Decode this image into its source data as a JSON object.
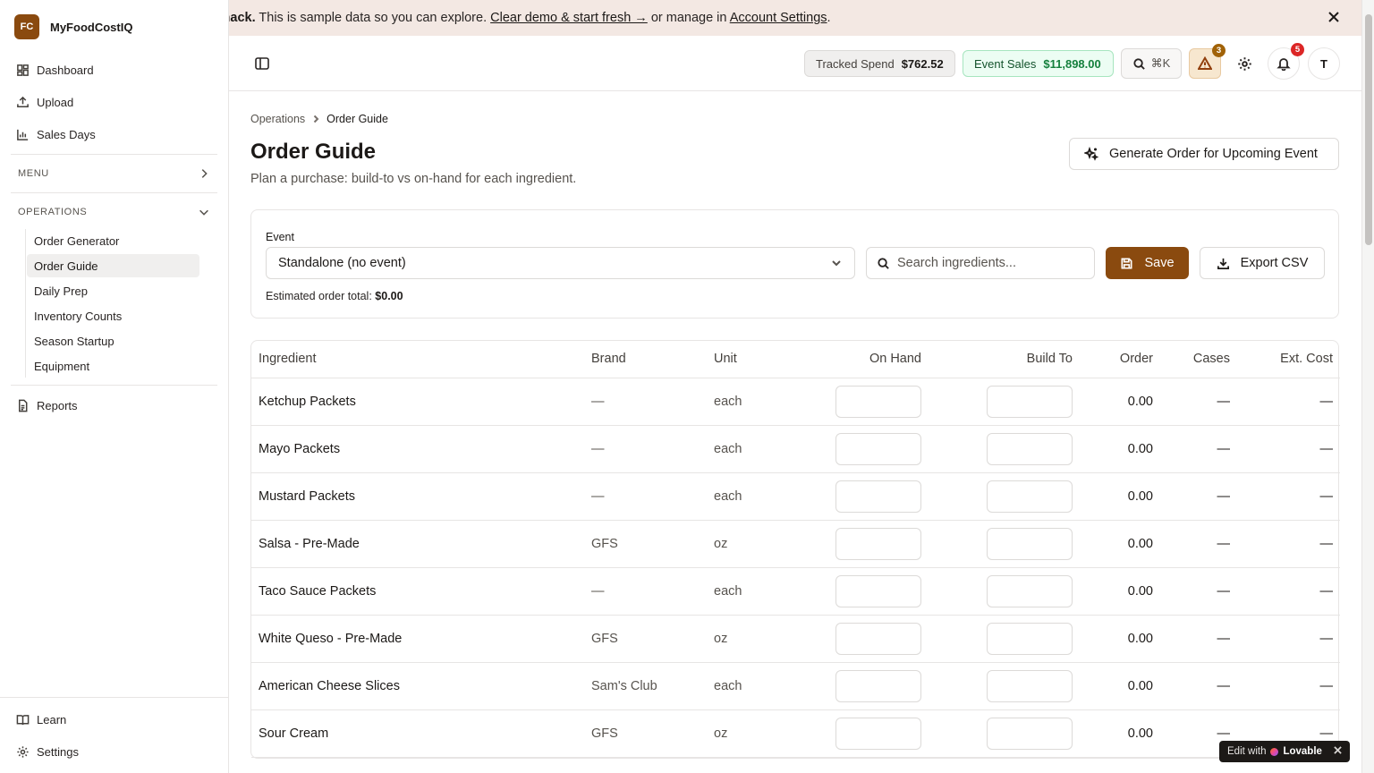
{
  "app": {
    "logo_initials": "FC",
    "name": "MyFoodCostIQ"
  },
  "sidebar": {
    "top_items": [
      {
        "label": "Dashboard",
        "icon": "dashboard-icon"
      },
      {
        "label": "Upload",
        "icon": "upload-icon"
      },
      {
        "label": "Sales Days",
        "icon": "bar-chart-icon"
      }
    ],
    "menu_group": "MENU",
    "operations_group": "OPERATIONS",
    "operations_items": [
      "Order Generator",
      "Order Guide",
      "Daily Prep",
      "Inventory Counts",
      "Season Startup",
      "Equipment"
    ],
    "active_item": "Order Guide",
    "reports": "Reports",
    "bottom_items": [
      {
        "label": "Learn",
        "icon": "book-icon"
      },
      {
        "label": "Settings",
        "icon": "gear-icon"
      }
    ]
  },
  "banner": {
    "lead": "d Shack.",
    "text": " This is sample data so you can explore. ",
    "clear_link": "Clear demo & start fresh →",
    "middle": " or manage in ",
    "settings_link": "Account Settings",
    "end": "."
  },
  "topbar": {
    "tracked_spend_label": "Tracked Spend",
    "tracked_spend_value": "$762.52",
    "event_sales_label": "Event Sales",
    "event_sales_value": "$11,898.00",
    "search_shortcut": "⌘K",
    "alerts_count": "3",
    "notifications_count": "5",
    "avatar_initial": "T"
  },
  "page": {
    "breadcrumb_parent": "Operations",
    "breadcrumb_current": "Order Guide",
    "title": "Order Guide",
    "subtitle": "Plan a purchase: build-to vs on-hand for each ingredient.",
    "generate_button": "Generate Order for Upcoming Event"
  },
  "filters": {
    "event_label": "Event",
    "event_value": "Standalone (no event)",
    "search_placeholder": "Search ingredients...",
    "save_label": "Save",
    "export_label": "Export CSV",
    "estimate_label": "Estimated order total:",
    "estimate_value": "$0.00"
  },
  "table": {
    "headers": [
      "Ingredient",
      "Brand",
      "Unit",
      "On Hand",
      "Build To",
      "Order",
      "Cases",
      "Ext. Cost"
    ],
    "rows": [
      {
        "ingredient": "Ketchup Packets",
        "brand": "—",
        "unit": "each",
        "order": "0.00",
        "cases": "—",
        "ext_cost": "—"
      },
      {
        "ingredient": "Mayo Packets",
        "brand": "—",
        "unit": "each",
        "order": "0.00",
        "cases": "—",
        "ext_cost": "—"
      },
      {
        "ingredient": "Mustard Packets",
        "brand": "—",
        "unit": "each",
        "order": "0.00",
        "cases": "—",
        "ext_cost": "—"
      },
      {
        "ingredient": "Salsa - Pre-Made",
        "brand": "GFS",
        "unit": "oz",
        "order": "0.00",
        "cases": "—",
        "ext_cost": "—"
      },
      {
        "ingredient": "Taco Sauce Packets",
        "brand": "—",
        "unit": "each",
        "order": "0.00",
        "cases": "—",
        "ext_cost": "—"
      },
      {
        "ingredient": "White Queso - Pre-Made",
        "brand": "GFS",
        "unit": "oz",
        "order": "0.00",
        "cases": "—",
        "ext_cost": "—"
      },
      {
        "ingredient": "American Cheese Slices",
        "brand": "Sam's Club",
        "unit": "each",
        "order": "0.00",
        "cases": "—",
        "ext_cost": "—"
      },
      {
        "ingredient": "Sour Cream",
        "brand": "GFS",
        "unit": "oz",
        "order": "0.00",
        "cases": "—",
        "ext_cost": "—"
      }
    ]
  },
  "lovable": {
    "prefix": "Edit with",
    "brand": "Lovable"
  },
  "colors": {
    "accent": "#8a4a0f",
    "sales_green": "#15803d",
    "banner_bg": "#f3e8e3",
    "notification_red": "#dc2626"
  }
}
